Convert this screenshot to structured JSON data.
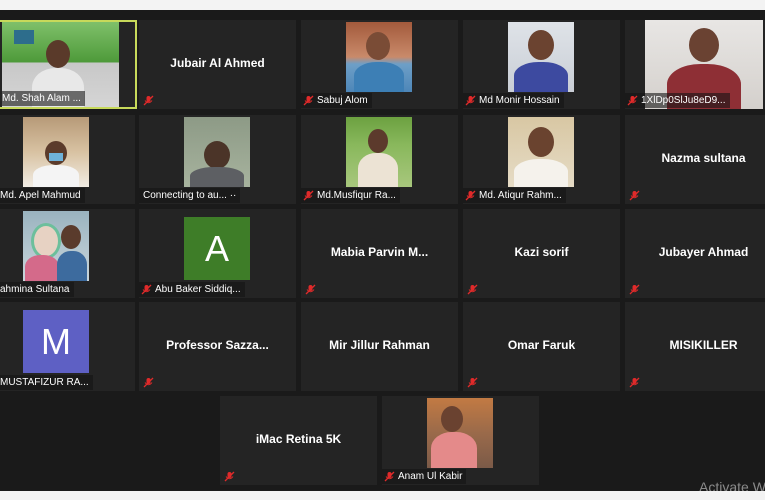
{
  "participants": [
    {
      "name": "Md. Shah Alam ..."
    },
    {
      "name": "Jubair Al Ahmed"
    },
    {
      "name": "Sabuj Alom"
    },
    {
      "name": "Md Monir Hossain"
    },
    {
      "name": "1XlDp0SlJu8eD9..."
    },
    {
      "name": "Md. Apel Mahmud"
    },
    {
      "name": "Connecting to au... ··"
    },
    {
      "name": "Md.Musfiqur Ra..."
    },
    {
      "name": "Md. Atiqur Rahm..."
    },
    {
      "name": "Nazma sultana"
    },
    {
      "name": "ahmina Sultana"
    },
    {
      "name": "Abu Baker Siddiq...",
      "avatar_letter": "A",
      "avatar_color": "#3e7d28"
    },
    {
      "name": "Mabia  Parvin  M..."
    },
    {
      "name": "Kazi sorif"
    },
    {
      "name": "Jubayer Ahmad"
    },
    {
      "name": "MUSTAFIZUR RA...",
      "avatar_letter": "M",
      "avatar_color": "#5e60c4"
    },
    {
      "name": "Professor  Sazza..."
    },
    {
      "name": "Mir Jillur Rahman"
    },
    {
      "name": "Omar Faruk"
    },
    {
      "name": "MISIKILLER"
    },
    {
      "name": "iMac Retina 5K"
    },
    {
      "name": "Anam Ul Kabir"
    }
  ],
  "watermark": "Activate W",
  "colors": {
    "active_speaker_border": "#c7d95a",
    "muted_icon": "#e02a2a",
    "tile_background": "#242424"
  },
  "icons": {
    "muted": "mic-muted-icon"
  }
}
